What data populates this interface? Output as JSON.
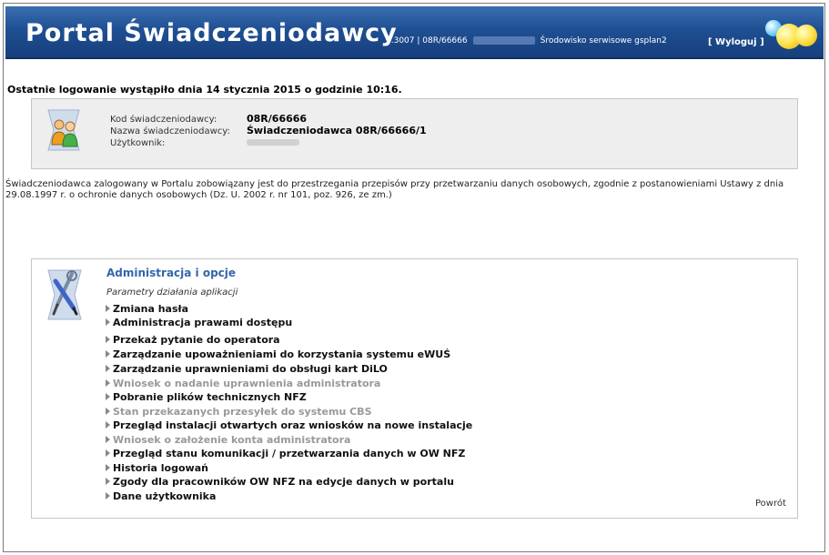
{
  "header": {
    "title": "Portal Świadczeniodawcy",
    "version": "2.3007 | 08R/66666",
    "environment": "Środowisko serwisowe gsplan2",
    "logout_label": "[ Wyloguj ]"
  },
  "last_login": "Ostatnie logowanie wystąpiło dnia 14 stycznia 2015 o godzinie 10:16.",
  "login_info": {
    "code_label": "Kod świadczeniodawcy:",
    "code_value": "08R/66666",
    "name_label": "Nazwa świadczeniodawcy:",
    "name_value": "Świadczeniodawca 08R/66666/1",
    "user_label": "Użytkownik:"
  },
  "notice": "Świadczeniodawca zalogowany w Portalu zobowiązany jest do przestrzegania przepisów przy przetwarzaniu danych osobowych, zgodnie z postanowieniami Ustawy z dnia 29.08.1997 r. o ochronie danych osobowych (Dz. U. 2002 r. nr 101, poz. 926, ze zm.)",
  "admin": {
    "title": "Administracja i opcje",
    "subtitle": "Parametry działania aplikacji",
    "items": [
      {
        "label": "Zmiana hasła",
        "enabled": true
      },
      {
        "label": "Administracja prawami dostępu",
        "enabled": true
      },
      {
        "label": "Przekaż pytanie do operatora",
        "enabled": true
      },
      {
        "label": "Zarządzanie upoważnieniami do korzystania systemu eWUŚ",
        "enabled": true
      },
      {
        "label": "Zarządzanie uprawnieniami do obsługi kart DiLO",
        "enabled": true
      },
      {
        "label": "Wniosek o nadanie uprawnienia administratora",
        "enabled": false
      },
      {
        "label": "Pobranie plików technicznych NFZ",
        "enabled": true
      },
      {
        "label": "Stan przekazanych przesyłek do systemu CBS",
        "enabled": false
      },
      {
        "label": "Przegląd instalacji otwartych oraz wniosków na nowe instalacje",
        "enabled": true
      },
      {
        "label": "Wniosek o założenie konta administratora",
        "enabled": false
      },
      {
        "label": "Przegląd stanu komunikacji / przetwarzania danych w OW NFZ",
        "enabled": true
      },
      {
        "label": "Historia logowań",
        "enabled": true
      },
      {
        "label": "Zgody dla pracowników OW NFZ na edycje danych w portalu",
        "enabled": true
      },
      {
        "label": "Dane użytkownika",
        "enabled": true
      }
    ],
    "back_label": "Powrót"
  },
  "colors": {
    "header_bg": "#1f4f93",
    "link": "#3366aa",
    "disabled": "#999999"
  }
}
